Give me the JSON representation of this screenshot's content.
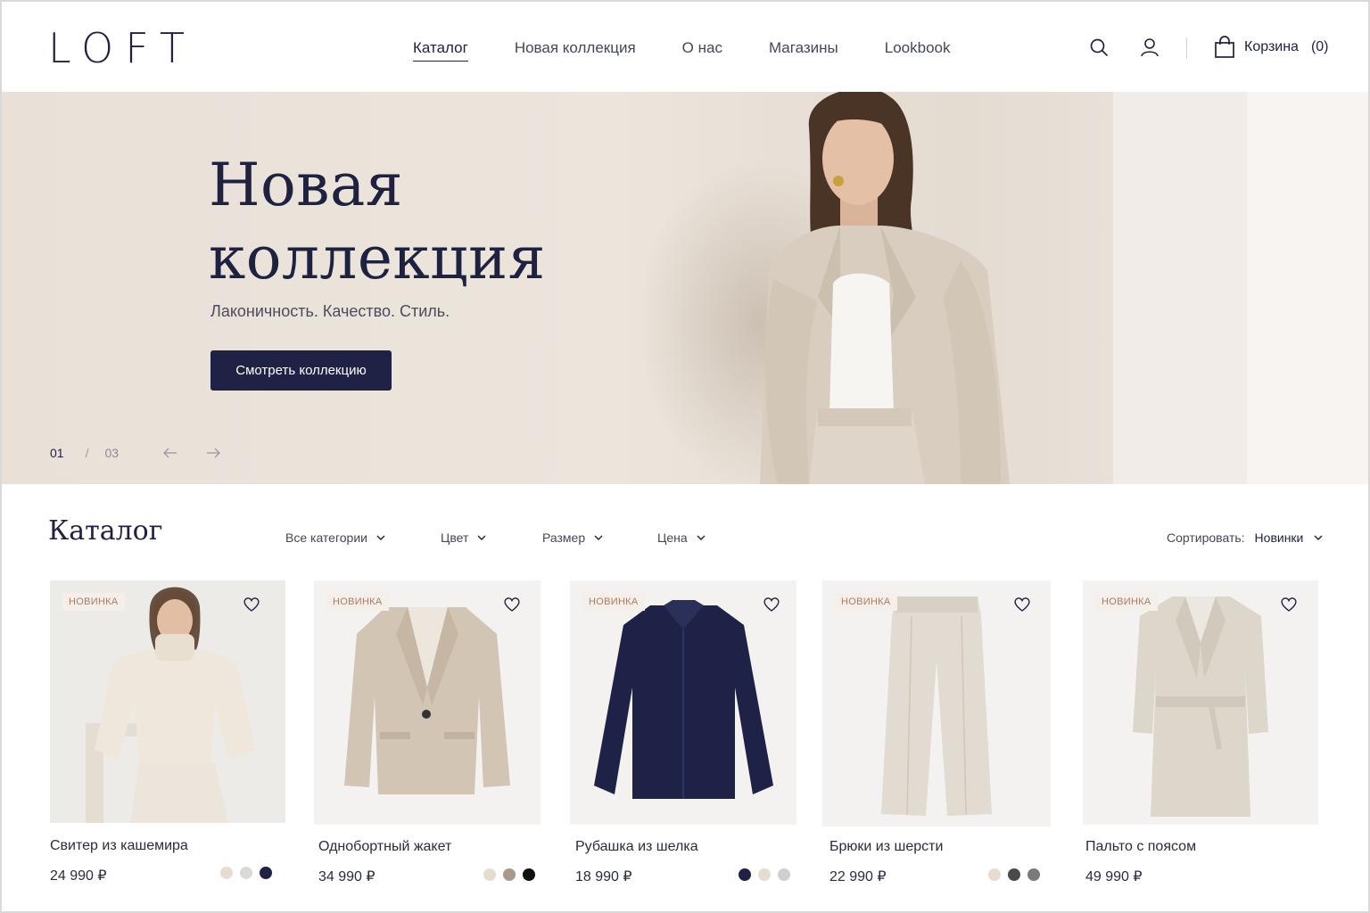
{
  "header": {
    "logo": "LOFT",
    "nav": [
      "Каталог",
      "Новая коллекция",
      "О нас",
      "Магазины",
      "Lookbook"
    ],
    "cart_label": "Корзина",
    "cart_count": "(0)"
  },
  "hero": {
    "title_line1": "Новая",
    "title_line2": "коллекция",
    "subtitle": "Лаконичность. Качество. Стиль.",
    "cta": "Смотреть коллекцию",
    "slide_current": "01",
    "slide_separator": "/",
    "slide_total": "03"
  },
  "catalog": {
    "title": "Каталог",
    "filters": [
      "Все категории",
      "Цвет",
      "Размер",
      "Цена"
    ],
    "sort_label": "Сортировать:",
    "sort_value": "Новинки",
    "badge": "НОВИНКА",
    "products": [
      {
        "name": "Свитер из кашемира",
        "price": "24 990 ₽",
        "colors": [
          "#e6dccf",
          "#dcdad6",
          "#1f2145"
        ]
      },
      {
        "name": "Однобортный жакет",
        "price": "34 990 ₽",
        "colors": [
          "#e6dccf",
          "#a89a8a",
          "#111111"
        ]
      },
      {
        "name": "Рубашка из шелка",
        "price": "18 990 ₽",
        "colors": [
          "#1f2145",
          "#e6dccf",
          "#cfcfcf"
        ]
      },
      {
        "name": "Брюки из шерсти",
        "price": "22 990 ₽",
        "colors": [
          "#e6dccf",
          "#4a4a4a",
          "#7a7a7a"
        ]
      },
      {
        "name": "Пальто с поясом",
        "price": "49 990 ₽",
        "colors": []
      }
    ]
  }
}
